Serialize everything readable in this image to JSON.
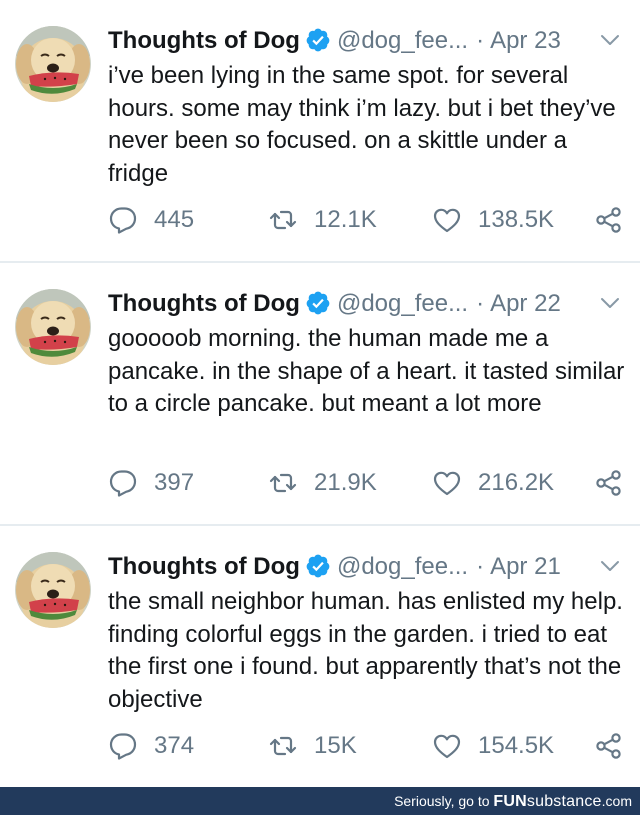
{
  "colors": {
    "verified_blue": "#1da1f2",
    "muted_gray": "#657786",
    "text": "#14171a",
    "separator": "#e6ecf0",
    "footer_bg": "#223a5c"
  },
  "icons": {
    "reply": "reply-icon",
    "retweet": "retweet-icon",
    "like": "heart-icon",
    "share": "share-icon",
    "verified": "verified-badge-icon",
    "menu": "chevron-down-icon"
  },
  "tweets": [
    {
      "name": "Thoughts of Dog",
      "handle": "@dog_fee...",
      "separator": "·",
      "date": "Apr 23",
      "text": "i’ve been lying in the same spot. for several hours. some may think i’m lazy. but i bet they’ve never been so focused. on a skittle under a fridge",
      "replies": "445",
      "retweets": "12.1K",
      "likes": "138.5K"
    },
    {
      "name": "Thoughts of Dog",
      "handle": "@dog_fee...",
      "separator": "·",
      "date": "Apr 22",
      "text": "gooooob morning. the human made me a pancake. in the shape of a heart. it tasted similar to a circle pancake. but meant a lot more",
      "replies": "397",
      "retweets": "21.9K",
      "likes": "216.2K"
    },
    {
      "name": "Thoughts of Dog",
      "handle": "@dog_fee...",
      "separator": "·",
      "date": "Apr 21",
      "text": "the small neighbor human. has enlisted my help. finding colorful eggs in the garden. i tried to eat the first one i found. but apparently that’s not the objective",
      "replies": "374",
      "retweets": "15K",
      "likes": "154.5K"
    }
  ],
  "footer": {
    "prefix": "Seriously, go to",
    "brand_bold": "FUN",
    "brand_rest": "substance",
    "suffix": ".com"
  }
}
